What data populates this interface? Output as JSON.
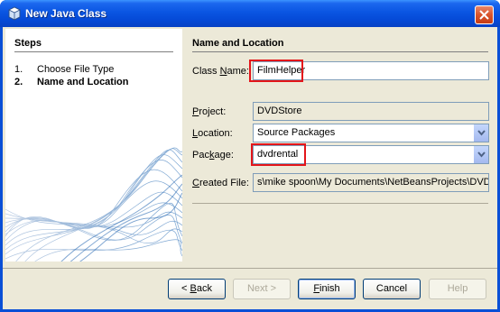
{
  "window": {
    "title": "New Java Class",
    "icon": "java-class-icon",
    "close_icon": "close-icon"
  },
  "steps": {
    "title": "Steps",
    "items": [
      {
        "number": "1.",
        "label": "Choose File Type",
        "current": false
      },
      {
        "number": "2.",
        "label": "Name and Location",
        "current": true
      }
    ]
  },
  "form": {
    "section_title": "Name and Location",
    "class_name": {
      "label_pre": "Class ",
      "label_mnemonic": "N",
      "label_post": "ame:",
      "value": "FilmHelper"
    },
    "project": {
      "label_pre": "",
      "label_mnemonic": "P",
      "label_post": "roject:",
      "value": "DVDStore"
    },
    "location": {
      "label_pre": "",
      "label_mnemonic": "L",
      "label_post": "ocation:",
      "value": "Source Packages"
    },
    "package": {
      "label_pre": "Pac",
      "label_mnemonic": "k",
      "label_post": "age:",
      "value": "dvdrental"
    },
    "created_file": {
      "label_pre": "",
      "label_mnemonic": "C",
      "label_post": "reated File:",
      "value": "s\\mike spoon\\My Documents\\NetBeansProjects\\DVDS"
    }
  },
  "buttons": {
    "back": {
      "pre": "< ",
      "mnemonic": "B",
      "post": "ack",
      "enabled": true
    },
    "next": {
      "label": "Next >",
      "enabled": false
    },
    "finish": {
      "pre": "",
      "mnemonic": "F",
      "post": "inish",
      "enabled": true
    },
    "cancel": {
      "label": "Cancel",
      "enabled": true
    },
    "help": {
      "label": "Help",
      "enabled": false
    }
  },
  "colors": {
    "title_bar": "#0a55e2",
    "dialog_bg": "#ece9d8",
    "highlight": "#e3151a"
  }
}
